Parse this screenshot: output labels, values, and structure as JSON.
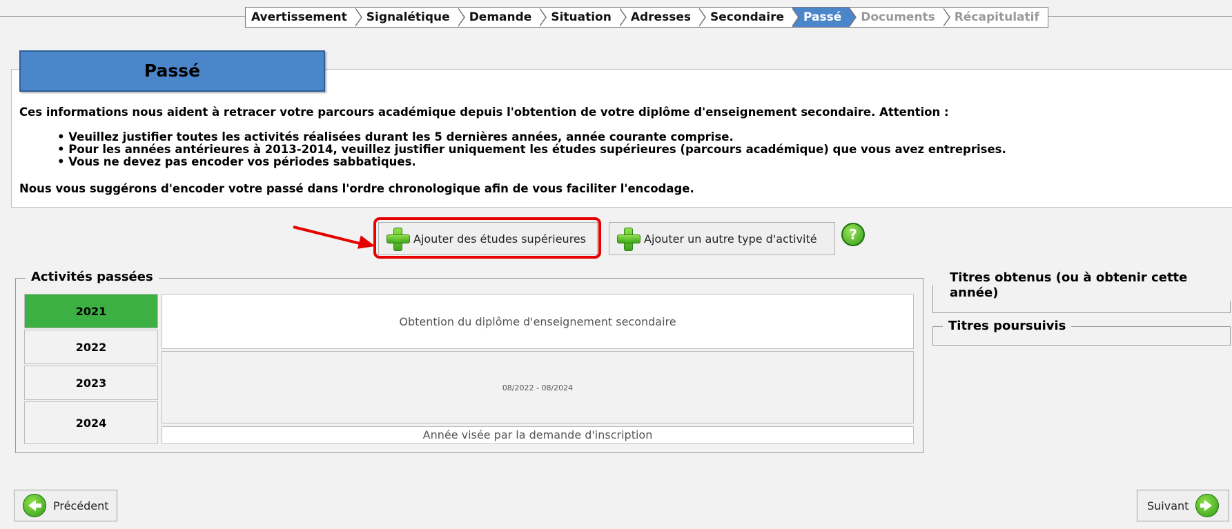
{
  "stepper": {
    "steps": [
      {
        "label": "Avertissement",
        "state": "done"
      },
      {
        "label": "Signalétique",
        "state": "done"
      },
      {
        "label": "Demande",
        "state": "done"
      },
      {
        "label": "Situation",
        "state": "done"
      },
      {
        "label": "Adresses",
        "state": "done"
      },
      {
        "label": "Secondaire",
        "state": "done"
      },
      {
        "label": "Passé",
        "state": "active"
      },
      {
        "label": "Documents",
        "state": "disabled"
      },
      {
        "label": "Récapitulatif",
        "state": "disabled"
      }
    ]
  },
  "page": {
    "title": "Passé",
    "intro": "Ces informations nous aident à retracer votre parcours académique depuis l'obtention de votre diplôme d'enseignement secondaire. Attention :",
    "bullets": [
      "Veuillez justifier toutes les activités réalisées durant les 5 dernières années, année courante comprise.",
      "Pour les années antérieures à 2013-2014, veuillez justifier uniquement les études supérieures (parcours académique) que vous avez entreprises.",
      "Vous ne devez pas encoder vos périodes sabbatiques."
    ],
    "suggestion": "Nous vous suggérons d'encoder votre passé dans l'ordre chronologique afin de vous faciliter l'encodage."
  },
  "actions": {
    "add_studies_label": "Ajouter des études supérieures",
    "add_other_label": "Ajouter un autre type d'activité",
    "help_glyph": "?"
  },
  "activities": {
    "legend": "Activités passées",
    "years": [
      "2021",
      "2022",
      "2023",
      "2024"
    ],
    "active_year": "2021",
    "entries": {
      "diploma": "Obtention du diplôme d'enseignement secondaire",
      "period": "08/2022 - 08/2024",
      "target_year": "Année visée par la demande d'inscription"
    }
  },
  "side": {
    "titles_obtained": "Titres obtenus (ou à obtenir cette année)",
    "titles_pursued": "Titres poursuivis"
  },
  "nav": {
    "previous_label": "Précédent",
    "next_label": "Suivant"
  },
  "colors": {
    "accent": "#4b86cb",
    "active_year": "#3cb043",
    "highlight": "#e60000"
  }
}
